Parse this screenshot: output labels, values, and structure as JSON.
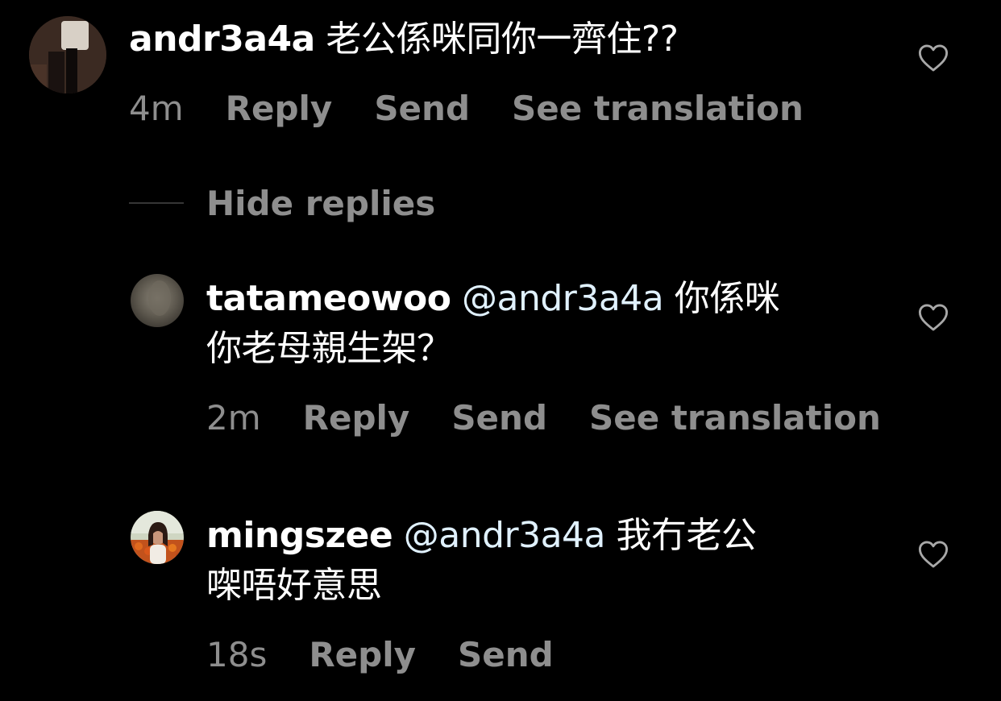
{
  "comments": [
    {
      "username": "andr3a4a",
      "mention": "",
      "text": "老公係咪同你一齊住??",
      "time": "4m",
      "reply_label": "Reply",
      "send_label": "Send",
      "translate_label": "See translation",
      "like_icon": "heart-outline-icon"
    },
    {
      "username": "tatameowoo",
      "mention": "@andr3a4a",
      "text_line1": "你係咪",
      "text_line2": "你老母親生架？",
      "time": "2m",
      "reply_label": "Reply",
      "send_label": "Send",
      "translate_label": "See translation",
      "like_icon": "heart-outline-icon"
    },
    {
      "username": "mingszee",
      "mention": "@andr3a4a",
      "text_line1": "我冇老公",
      "text_line2": "㗎唔好意思",
      "time": "18s",
      "reply_label": "Reply",
      "send_label": "Send",
      "like_icon": "heart-outline-icon"
    }
  ],
  "hide_replies_label": "Hide replies",
  "colors": {
    "background": "#000000",
    "text": "#ffffff",
    "secondary": "#8e8e8e",
    "mention": "#e0f1ff",
    "divider": "#363636"
  }
}
